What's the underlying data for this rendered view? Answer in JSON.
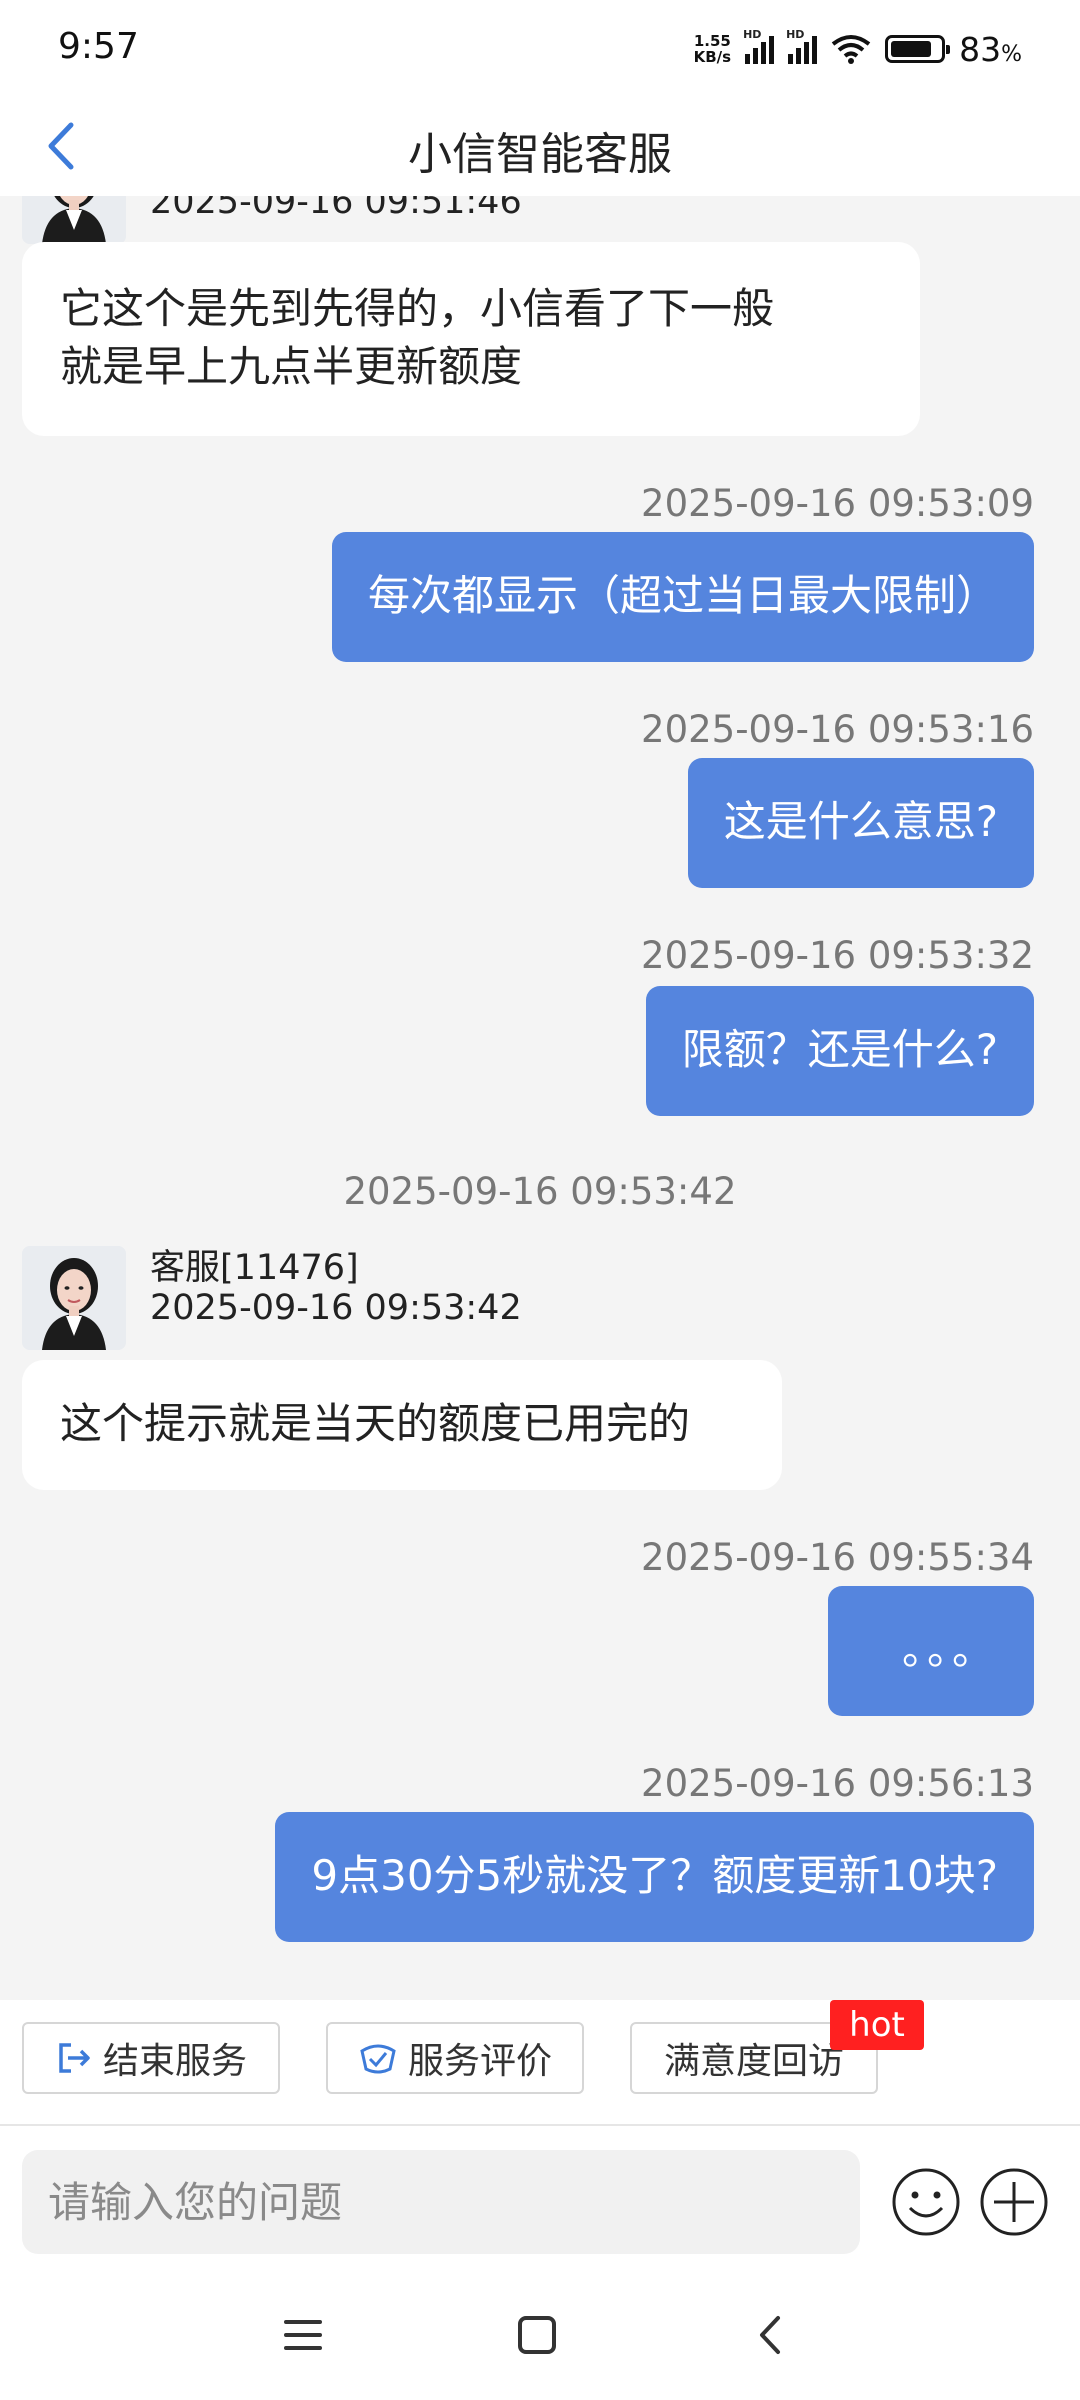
{
  "status_bar": {
    "time": "9:57",
    "net_speed_value": "1.55",
    "net_speed_unit": "KB/s",
    "hd_label": "HD",
    "battery_percent": "83",
    "battery_symbol": "%",
    "battery_level": 0.83
  },
  "nav": {
    "title": "小信智能客服",
    "back_icon": "chevron-left-icon"
  },
  "chat": {
    "top_partial_meta": "2025-09-16 09:51:46",
    "messages": [
      {
        "side": "left",
        "text_line1": "它这个是先到先得的，小信看了下一般",
        "text_line2": "就是早上九点半更新额度"
      },
      {
        "side": "right",
        "time": "2025-09-16 09:53:09",
        "text": "每次都显示（超过当日最大限制）"
      },
      {
        "side": "right",
        "time": "2025-09-16 09:53:16",
        "text": "这是什么意思?"
      },
      {
        "side": "right",
        "time": "2025-09-16 09:53:32",
        "text": "限额？还是什么?"
      },
      {
        "side": "center-time",
        "time": "2025-09-16 09:53:42"
      },
      {
        "side": "left",
        "agent_name": "客服[11476]",
        "agent_time": "2025-09-16 09:53:42",
        "text": "这个提示就是当天的额度已用完的"
      },
      {
        "side": "right",
        "time": "2025-09-16 09:55:34",
        "text": "。。。"
      },
      {
        "side": "right",
        "time": "2025-09-16 09:56:13",
        "text": "9点30分5秒就没了？额度更新10块?"
      }
    ]
  },
  "actions": {
    "end_service": "结束服务",
    "rate_service": "服务评价",
    "satisfaction": "满意度回访",
    "hot_badge": "hot"
  },
  "input": {
    "placeholder": "请输入您的问题"
  },
  "colors": {
    "user_bubble": "#5585de",
    "agent_bubble": "#ffffff",
    "background": "#f4f4f4",
    "accent": "#3d7bd9",
    "hot": "#ff2020"
  }
}
